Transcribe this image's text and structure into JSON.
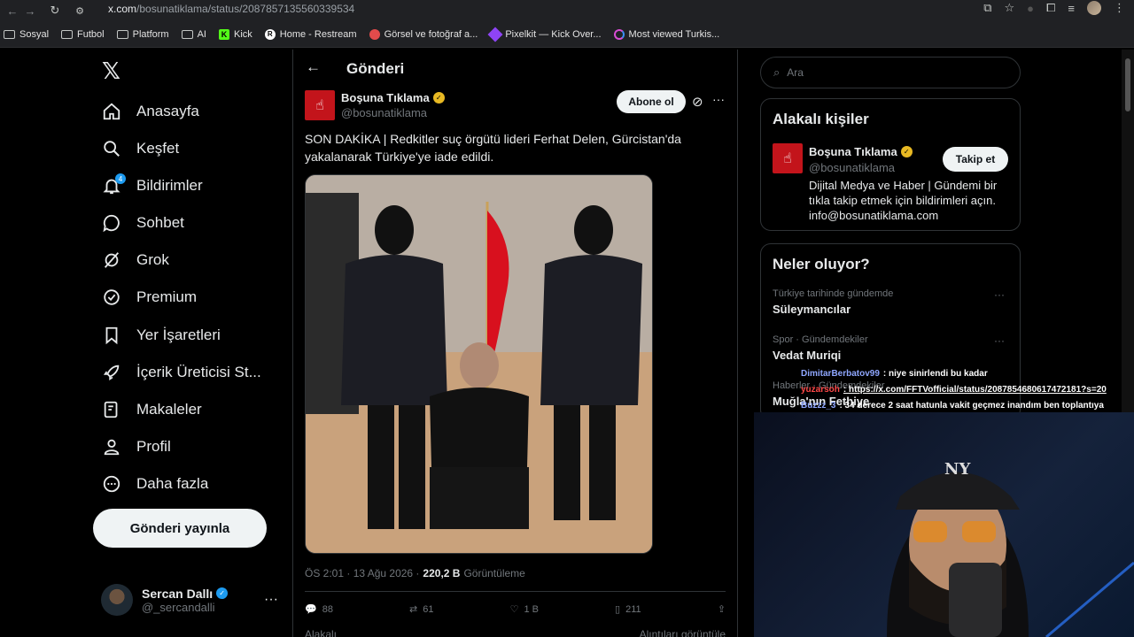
{
  "browser": {
    "url_host": "x.com",
    "url_path": "/bosunatiklama/status/2087857135560339534",
    "bookmarks": [
      "Sosyal",
      "Futbol",
      "Platform",
      "AI",
      "Kick",
      "Home - Restream",
      "Görsel ve fotoğraf a...",
      "Pixelkit — Kick Over...",
      "Most viewed Turkis..."
    ]
  },
  "nav": {
    "items": [
      {
        "label": "Anasayfa",
        "icon": "home-icon"
      },
      {
        "label": "Keşfet",
        "icon": "search-icon"
      },
      {
        "label": "Bildirimler",
        "icon": "bell-icon",
        "badge": "4"
      },
      {
        "label": "Sohbet",
        "icon": "chat-icon"
      },
      {
        "label": "Grok",
        "icon": "grok-icon"
      },
      {
        "label": "Premium",
        "icon": "premium-icon"
      },
      {
        "label": "Yer İşaretleri",
        "icon": "bookmark-icon"
      },
      {
        "label": "İçerik Üreticisi St...",
        "icon": "rocket-icon"
      },
      {
        "label": "Makaleler",
        "icon": "article-icon"
      },
      {
        "label": "Profil",
        "icon": "person-icon"
      },
      {
        "label": "Daha fazla",
        "icon": "more-icon"
      }
    ],
    "post_button": "Gönderi yayınla",
    "user": {
      "name": "Sercan Dallı",
      "handle": "@_sercandalli"
    }
  },
  "post": {
    "header_title": "Gönderi",
    "author_name": "Boşuna Tıklama",
    "author_handle": "@bosunatiklama",
    "subscribe_label": "Abone ol",
    "text": "SON DAKİKA | Redkitler suç örgütü lideri Ferhat Delen, Gürcistan'da yakalanarak Türkiye'ye iade edildi.",
    "time": "ÖS 2:01 · 13 Ağu 2026 ·",
    "views_value": "220,2 B",
    "views_label": "Görüntüleme",
    "stats": {
      "replies": "88",
      "reposts": "61",
      "likes": "1 B",
      "bookmarks": "211"
    },
    "bottom_left": "Alakalı",
    "bottom_right": "Alıntıları görüntüle"
  },
  "sidebar": {
    "search_placeholder": "Ara",
    "related_title": "Alakalı kişiler",
    "related": {
      "name": "Boşuna Tıklama",
      "handle": "@bosunatiklama",
      "follow_label": "Takip et",
      "bio": "Dijital Medya ve Haber | Gündemi bir tıkla takip etmek için bildirimleri açın. info@bosunatiklama.com"
    },
    "trends_title": "Neler oluyor?",
    "trends": [
      {
        "context": "Türkiye tarihinde gündemde",
        "name": "Süleymancılar"
      },
      {
        "context": "Spor · Gündemdekiler",
        "name": "Vedat Muriqi"
      },
      {
        "context": "Haberler · Gündemdekiler",
        "name": "Muğla'nın Fethiye"
      }
    ]
  },
  "overlay_chat": [
    {
      "user": "DimitarBerbatov99",
      "msg": ": niye sinirlendi bu kadar"
    },
    {
      "user": "yuzarsoh",
      "msg": ": https://x.com/FFTVofficial/status/2087854680617472181?s=20"
    },
    {
      "user": "Buzzz_3",
      "msg": ": 34 derece 2 saat hatunla vakit geçmez inandım ben toplantıya"
    }
  ],
  "colors": {
    "accent": "#1d9bf0",
    "brand_red": "#c3141b",
    "verified_gold": "#e8b923"
  }
}
